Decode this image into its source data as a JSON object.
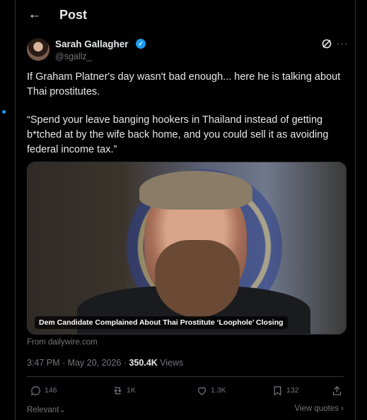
{
  "header": {
    "back_icon": "arrow-left-icon",
    "title": "Post"
  },
  "author": {
    "name": "Sarah Gallagher",
    "handle": "@sgallz_",
    "verified_icon": "verified-badge-icon"
  },
  "post": {
    "paragraph1": "If Graham Platner's day wasn't bad enough... here he is talking about Thai prostitutes.",
    "paragraph2": "“Spend your leave banging hookers in Thailand instead of getting b*tched at by the wife back home, and you could sell it as avoiding federal income tax.”"
  },
  "media": {
    "caption": "Dem Candidate Complained About Thai Prostitute ‘Loophole’ Closing",
    "source": "From dailywire.com"
  },
  "meta": {
    "timestamp": "3:47 PM · May 20, 2026 · ",
    "views_count": "350.4K",
    "views_label": " Views"
  },
  "actions": {
    "replies": "146",
    "reposts": "1K",
    "likes": "1.3K",
    "bookmarks": "132"
  },
  "footer": {
    "sort_label": "Relevant",
    "view_quotes": "View quotes"
  },
  "colors": {
    "accent": "#1d9bf0",
    "background": "#000000",
    "muted": "#71767b"
  }
}
